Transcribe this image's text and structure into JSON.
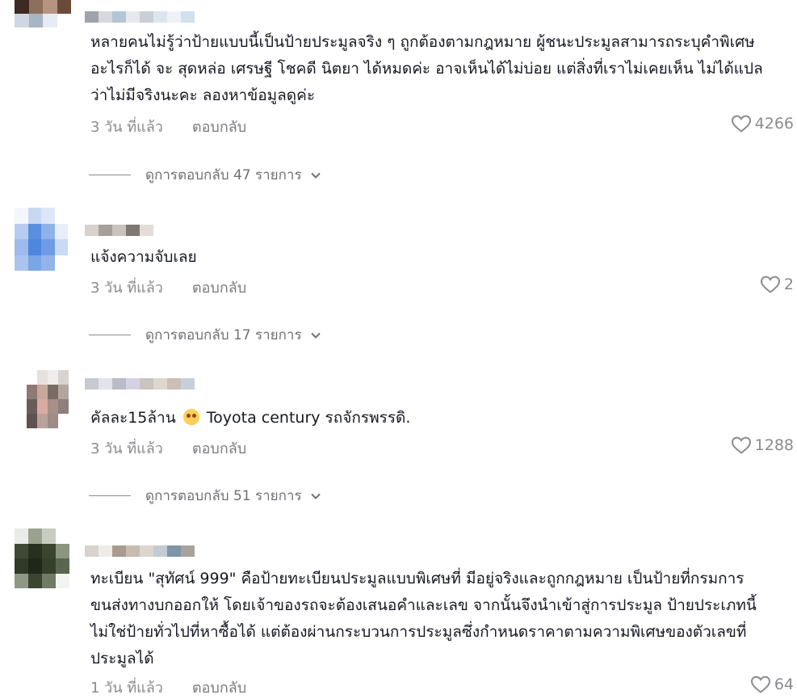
{
  "comments": [
    {
      "text": "หลายคนไม่รู้ว่าป้ายแบบนี้เป็นป้ายประมูลจริง ๆ ถูกต้องตามกฎหมาย ผู้ชนะประมูลสามารถระบุคำพิเศษอะไรก็ได้ จะ สุดหล่อ เศรษฐี โชคดี นิตยา ได้หมดค่ะ อาจเห็นได้ไม่บ่อย แต่สิ่งที่เราไม่เคยเห็น ไม่ได้แปลว่าไม่มีจริงนะคะ ลองหาข้อมูลดูค่ะ",
      "time": "3 วัน ที่แล้ว",
      "reply": "ตอบกลับ",
      "likes": "4266",
      "replies": "ดูการตอบกลับ 47 รายการ"
    },
    {
      "text": "แจ้งความจับเลย",
      "time": "3 วัน ที่แล้ว",
      "reply": "ตอบกลับ",
      "likes": "2",
      "replies": "ดูการตอบกลับ 17 รายการ"
    },
    {
      "text_before": "คัลละ15ล้าน",
      "emoji": "hot-face-emoji",
      "text_after": "Toyota century รถจักรพรรดิ.",
      "time": "3 วัน ที่แล้ว",
      "reply": "ตอบกลับ",
      "likes": "1288",
      "replies": "ดูการตอบกลับ 51 รายการ"
    },
    {
      "text": "ทะเบียน \"สุทัศน์ 999\" คือป้ายทะเบียนประมูลแบบพิเศษที่ มีอยู่จริงและถูกกฎหมาย เป็นป้ายที่กรมการขนส่งทางบกออกให้ โดยเจ้าของรถจะต้องเสนอคำและเลข จากนั้นจึงนำเข้าสู่การประมูล ป้ายประเภทนี้ไม่ใช่ป้ายทั่วไปที่หาซื้อได้ แต่ต้องผ่านกระบวนการประมูลซึ่งกำหนดราคาตามความพิเศษของตัวเลขที่ประมูลได้",
      "time": "1 วัน ที่แล้ว",
      "reply": "ตอบกลับ",
      "likes": "64"
    }
  ],
  "icons": {
    "like": "heart-outline-icon",
    "expand": "chevron-down-icon"
  },
  "colors": {
    "text": "#161823",
    "muted": "#8a8b91"
  }
}
